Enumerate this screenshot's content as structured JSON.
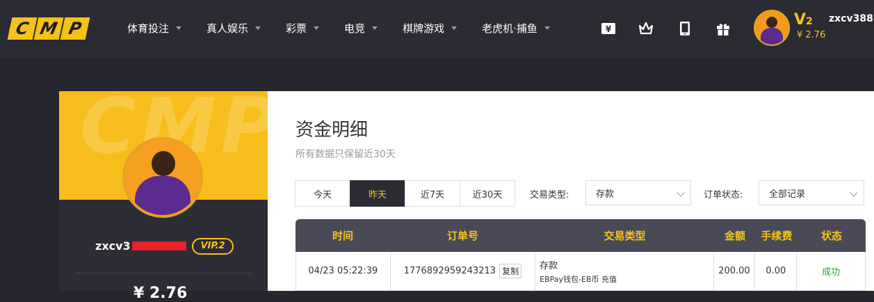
{
  "header": {
    "logo_letters": [
      "C",
      "M",
      "P"
    ],
    "nav": [
      {
        "label": "体育投注"
      },
      {
        "label": "真人娱乐"
      },
      {
        "label": "彩票"
      },
      {
        "label": "电竞"
      },
      {
        "label": "棋牌游戏"
      },
      {
        "label": "老虎机·捕鱼"
      }
    ],
    "tools": [
      "yen-ticket-icon",
      "crown-icon",
      "tablet-icon",
      "gift-icon"
    ],
    "user": {
      "vip_letter": "V",
      "vip_num": "2",
      "balance": "¥ 2.76",
      "username": "zxcv388"
    }
  },
  "profile": {
    "watermark": "CMP",
    "username_visible": "zxcv3",
    "vip_badge": "VIP.2",
    "partial_text": "¥ 2.76"
  },
  "page": {
    "title": "资金明细",
    "subtitle": "所有数据只保留近30天"
  },
  "filters": {
    "periods": [
      "今天",
      "昨天",
      "近7天",
      "近30天"
    ],
    "active_period": "昨天",
    "type_label": "交易类型:",
    "type_value": "存款",
    "status_label": "订单状态:",
    "status_value": "全部记录"
  },
  "table": {
    "headers": [
      "时间",
      "订单号",
      "交易类型",
      "金额",
      "手续费",
      "状态"
    ],
    "rows": [
      {
        "time": "04/23 05:22:39",
        "order_no": "1776892959243213",
        "copy": "复制",
        "type_main": "存款",
        "type_sub": "EBPay钱包-EB币 充值",
        "amount": "200.00",
        "fee": "0.00",
        "status": "成功"
      }
    ]
  },
  "colors": {
    "accent": "#f5c21b",
    "nav_bg": "#2b2b33",
    "success": "#2e9e3a"
  }
}
